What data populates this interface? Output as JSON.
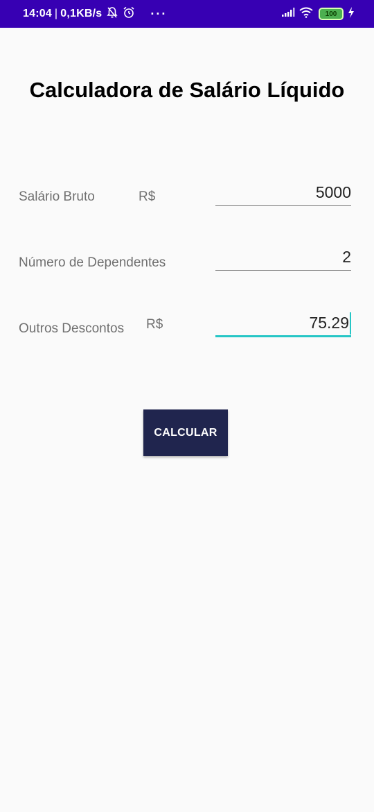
{
  "status_bar": {
    "time": "14:04",
    "separator": "|",
    "speed": "0,1KB/s",
    "more": "···",
    "battery": "100",
    "icons": [
      "bell-off-icon",
      "alarm-icon",
      "signal-icon",
      "wifi-icon",
      "battery-icon",
      "charging-icon"
    ],
    "colors": {
      "background": "#3700b3"
    }
  },
  "title": "Calculadora de Salário Líquido",
  "form": {
    "salary": {
      "label": "Salário Bruto",
      "currency": "R$",
      "value": "5000"
    },
    "dependents": {
      "label": "Número de Dependentes",
      "value": "2"
    },
    "discounts": {
      "label": "Outros Descontos",
      "currency": "R$",
      "value": "75.29"
    }
  },
  "calculate_button": {
    "label": "CALCULAR"
  },
  "colors": {
    "accent": "#26c6c6",
    "button": "#20254e"
  }
}
